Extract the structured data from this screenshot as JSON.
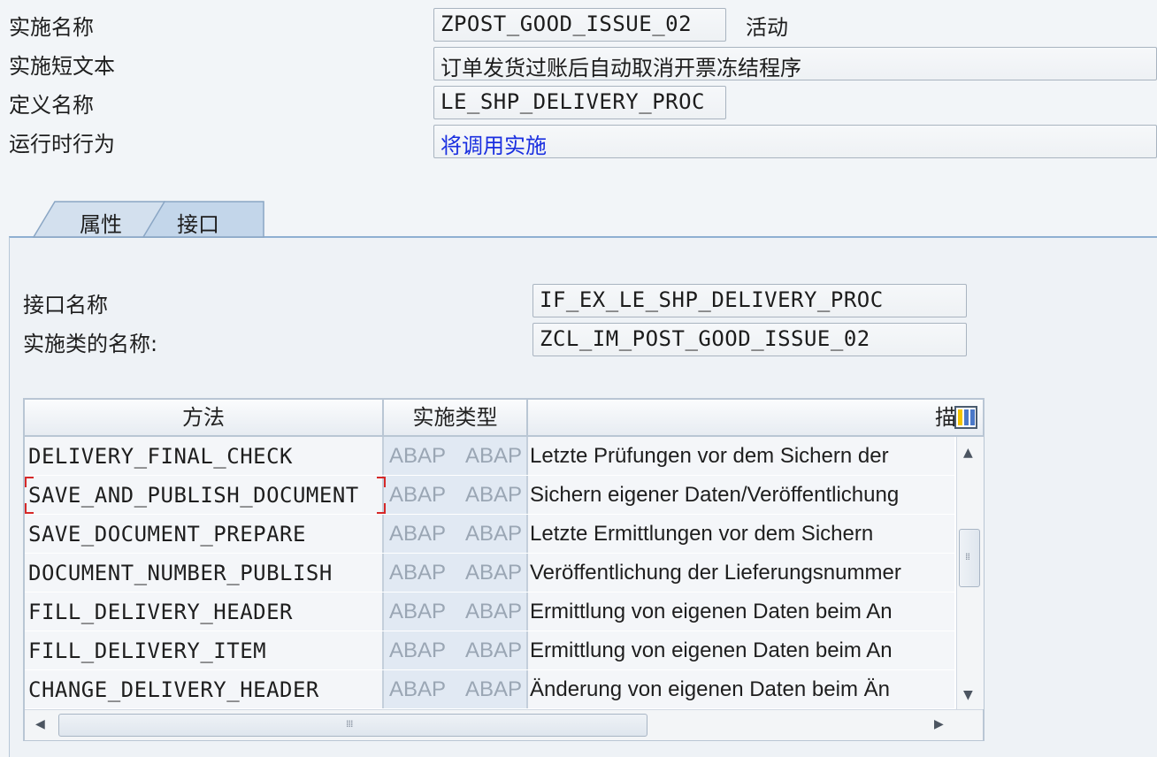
{
  "header": {
    "impl_name_label": "实施名称",
    "impl_name_value": "ZPOST_GOOD_ISSUE_02",
    "impl_status": "活动",
    "short_text_label": "实施短文本",
    "short_text_value": "订单发货过账后自动取消开票冻结程序",
    "definition_label": "定义名称",
    "definition_value": "LE_SHP_DELIVERY_PROC",
    "runtime_label": "运行时行为",
    "runtime_value": "将调用实施"
  },
  "tabs": [
    {
      "label": "属性",
      "active": false
    },
    {
      "label": "接口",
      "active": true
    }
  ],
  "interface": {
    "name_label": "接口名称",
    "name_value": "IF_EX_LE_SHP_DELIVERY_PROC",
    "class_label": "实施类的名称:",
    "class_value": "ZCL_IM_POST_GOOD_ISSUE_02"
  },
  "table": {
    "columns": [
      "方法",
      "实施类型",
      "描"
    ],
    "rows": [
      {
        "method": "DELIVERY_FINAL_CHECK",
        "type1": "ABAP",
        "type2": "ABAP",
        "desc": "Letzte Prüfungen vor dem Sichern der"
      },
      {
        "method": "SAVE_AND_PUBLISH_DOCUMENT",
        "type1": "ABAP",
        "type2": "ABAP",
        "desc": "Sichern eigener Daten/Veröffentlichung"
      },
      {
        "method": "SAVE_DOCUMENT_PREPARE",
        "type1": "ABAP",
        "type2": "ABAP",
        "desc": "Letzte Ermittlungen vor dem Sichern"
      },
      {
        "method": "DOCUMENT_NUMBER_PUBLISH",
        "type1": "ABAP",
        "type2": "ABAP",
        "desc": "Veröffentlichung der Lieferungsnummer"
      },
      {
        "method": "FILL_DELIVERY_HEADER",
        "type1": "ABAP",
        "type2": "ABAP",
        "desc": "Ermittlung von eigenen Daten beim An"
      },
      {
        "method": "FILL_DELIVERY_ITEM",
        "type1": "ABAP",
        "type2": "ABAP",
        "desc": "Ermittlung von eigenen Daten beim An"
      },
      {
        "method": "CHANGE_DELIVERY_HEADER",
        "type1": "ABAP",
        "type2": "ABAP",
        "desc": "Änderung von eigenen Daten beim Än"
      }
    ],
    "selected_row": 1
  },
  "icons": {
    "settings": "column-settings-icon",
    "scroll_up": "arrow-up-icon",
    "scroll_down": "arrow-down-icon",
    "scroll_left": "arrow-left-icon",
    "scroll_right": "arrow-right-icon"
  },
  "colors": {
    "runtime_text": "#1a2fe0",
    "selection_mark": "#d62828",
    "tab_border": "#8aa6c4"
  }
}
